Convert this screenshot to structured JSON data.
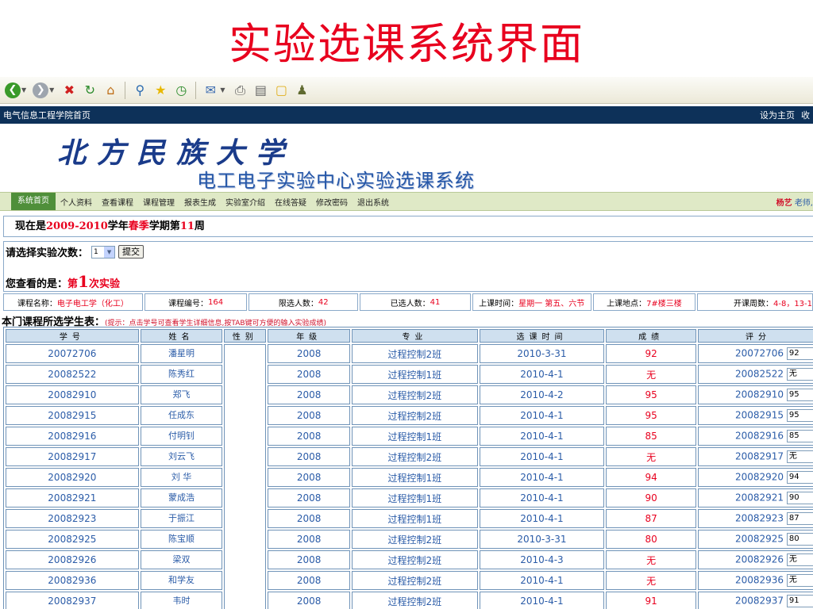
{
  "slide_title": "实验选课系统界面",
  "toolbar": {
    "icons": [
      "back-icon",
      "forward-icon",
      "stop-icon",
      "refresh-icon",
      "home-icon",
      "search-icon",
      "favorites-icon",
      "history-icon",
      "mail-icon",
      "print-icon",
      "edit-icon",
      "folder-icon",
      "messenger-icon"
    ]
  },
  "topbar": {
    "left": "电气信息工程学院首页",
    "set_home": "设为主页",
    "favorite": "收"
  },
  "banner": {
    "university": "北方民族大学",
    "system": "电工电子实验中心实验选课系统"
  },
  "nav": {
    "items": [
      "系统首页",
      "个人资料",
      "查看课程",
      "课程管理",
      "报表生成",
      "实验室介绍",
      "在线答疑",
      "修改密码",
      "退出系统"
    ],
    "user": "杨艺",
    "role": "老师,"
  },
  "term": {
    "prefix": "现在是",
    "years": "2009-2010",
    "mid1": "学年",
    "season": "春季",
    "mid2": "学期第",
    "week": "11",
    "suffix": "周"
  },
  "select": {
    "label": "请选择实验次数：",
    "value": "1",
    "submit": "提交"
  },
  "viewing": {
    "label": "您查看的是：",
    "pre": "第",
    "num": "1",
    "post": "次实验"
  },
  "course": {
    "name_label": "课程名称：",
    "name": "电子电工学（化工）",
    "code_label": "课程编号：",
    "code": "164",
    "limit_label": "限选人数：",
    "limit": "42",
    "selected_label": "已选人数：",
    "selected": "41",
    "time_label": "上课时间：",
    "time": "星期一 第五、六节",
    "place_label": "上课地点：",
    "place": "7#楼三楼",
    "weeks_label": "开课周数：",
    "weeks": "4-8，13-1"
  },
  "table": {
    "title": "本门课程所选学生表：",
    "hint": "(提示：点击学号可查看学生详细信息,按TAB键可方便的输入实验成绩)",
    "headers": [
      "学号",
      "姓名",
      "性别",
      "年级",
      "专业",
      "选课时间",
      "成绩",
      "评分"
    ],
    "rows": [
      {
        "id": "20072706",
        "name": "潘星明",
        "gender": "",
        "grade": "2008",
        "major": "过程控制2班",
        "time": "2010-3-31",
        "score": "92",
        "input": "92"
      },
      {
        "id": "20082522",
        "name": "陈秀红",
        "gender": "",
        "grade": "2008",
        "major": "过程控制1班",
        "time": "2010-4-1",
        "score": "无",
        "input": "无"
      },
      {
        "id": "20082910",
        "name": "郑飞",
        "gender": "",
        "grade": "2008",
        "major": "过程控制2班",
        "time": "2010-4-2",
        "score": "95",
        "input": "95"
      },
      {
        "id": "20082915",
        "name": "任成东",
        "gender": "",
        "grade": "2008",
        "major": "过程控制2班",
        "time": "2010-4-1",
        "score": "95",
        "input": "95"
      },
      {
        "id": "20082916",
        "name": "付明钊",
        "gender": "",
        "grade": "2008",
        "major": "过程控制1班",
        "time": "2010-4-1",
        "score": "85",
        "input": "85"
      },
      {
        "id": "20082917",
        "name": "刘云飞",
        "gender": "",
        "grade": "2008",
        "major": "过程控制2班",
        "time": "2010-4-1",
        "score": "无",
        "input": "无"
      },
      {
        "id": "20082920",
        "name": "刘 华",
        "gender": "",
        "grade": "2008",
        "major": "过程控制1班",
        "time": "2010-4-1",
        "score": "94",
        "input": "94"
      },
      {
        "id": "20082921",
        "name": "蒙成浩",
        "gender": "",
        "grade": "2008",
        "major": "过程控制1班",
        "time": "2010-4-1",
        "score": "90",
        "input": "90"
      },
      {
        "id": "20082923",
        "name": "于振江",
        "gender": "",
        "grade": "2008",
        "major": "过程控制1班",
        "time": "2010-4-1",
        "score": "87",
        "input": "87"
      },
      {
        "id": "20082925",
        "name": "陈宝顺",
        "gender": "",
        "grade": "2008",
        "major": "过程控制2班",
        "time": "2010-3-31",
        "score": "80",
        "input": "80"
      },
      {
        "id": "20082926",
        "name": "梁双",
        "gender": "",
        "grade": "2008",
        "major": "过程控制2班",
        "time": "2010-4-3",
        "score": "无",
        "input": "无"
      },
      {
        "id": "20082936",
        "name": "和学友",
        "gender": "",
        "grade": "2008",
        "major": "过程控制2班",
        "time": "2010-4-1",
        "score": "无",
        "input": "无"
      },
      {
        "id": "20082937",
        "name": "韦时",
        "gender": "",
        "grade": "2008",
        "major": "过程控制2班",
        "time": "2010-4-1",
        "score": "91",
        "input": "91"
      }
    ]
  }
}
